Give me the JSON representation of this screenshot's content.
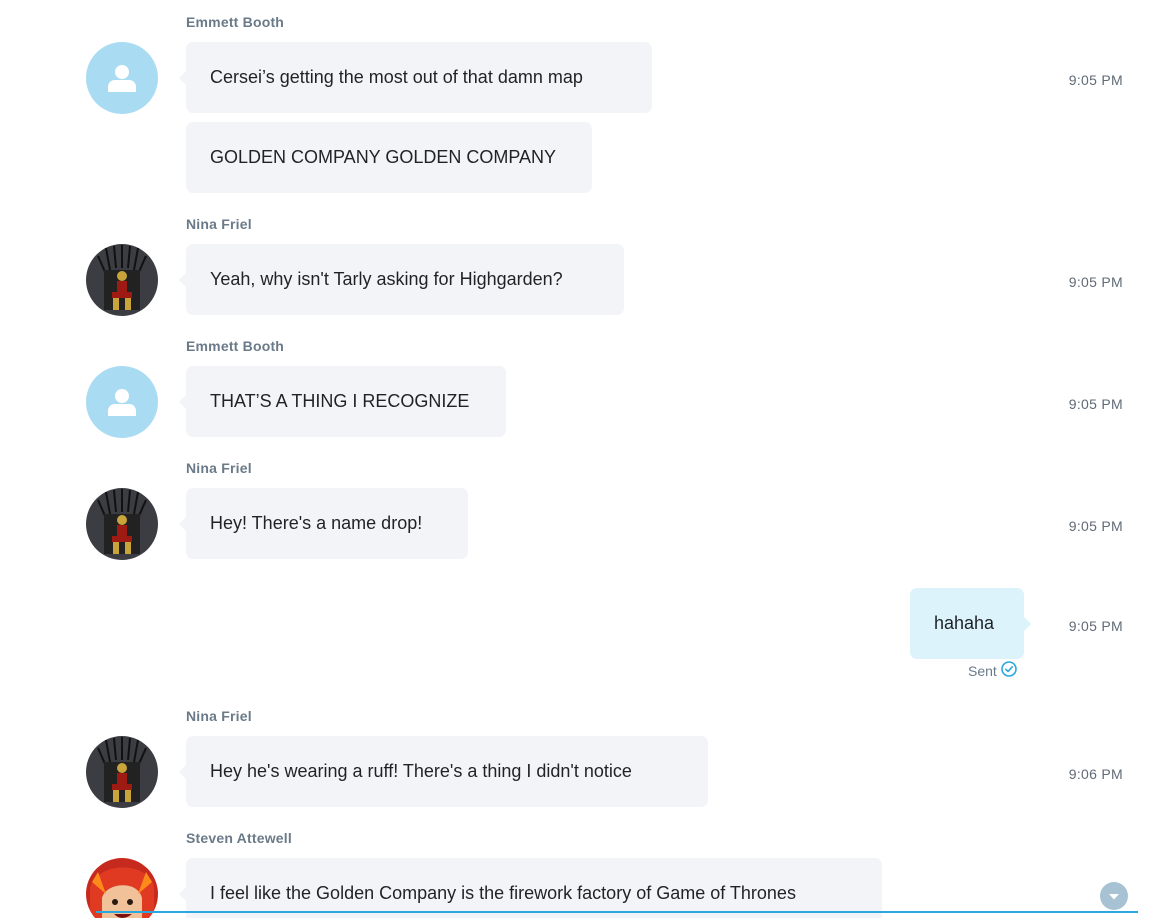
{
  "conversation": {
    "messages": [
      {
        "sender": "Emmett Booth",
        "text": "Cersei’s getting the most out of that damn map",
        "time": "9:05 PM",
        "avatar": "default-user-icon"
      },
      {
        "text": "GOLDEN COMPANY GOLDEN COMPANY"
      },
      {
        "sender": "Nina Friel",
        "text": "Yeah, why isn't Tarly asking for Highgarden?",
        "time": "9:05 PM",
        "avatar": "iron-man-throne-avatar"
      },
      {
        "sender": "Emmett Booth",
        "text": "THAT’S A THING I RECOGNIZE",
        "time": "9:05 PM",
        "avatar": "default-user-icon"
      },
      {
        "sender": "Nina Friel",
        "text": "Hey! There's a name drop!",
        "time": "9:05 PM",
        "avatar": "iron-man-throne-avatar"
      },
      {
        "text": "hahaha",
        "time": "9:05 PM",
        "status": "Sent",
        "status_icon": "check-circle-icon"
      },
      {
        "sender": "Nina Friel",
        "text": "Hey he's wearing a ruff! There's a thing I didn't notice",
        "time": "9:06 PM",
        "avatar": "iron-man-throne-avatar"
      },
      {
        "sender": "Steven Attewell",
        "text": "I feel like the Golden Company is the firework factory of Game of Thrones",
        "avatar": "cartoon-character-avatar"
      }
    ]
  },
  "scroll_button": {
    "icon": "chevron-down-icon"
  },
  "colors": {
    "bubble_incoming": "#f2f4f7",
    "bubble_outgoing": "#dcf3fc",
    "default_avatar": "#a9dbf2",
    "accent": "#2aa7df",
    "sender_name": "#6b7a89",
    "timestamp": "#5f6b77"
  }
}
